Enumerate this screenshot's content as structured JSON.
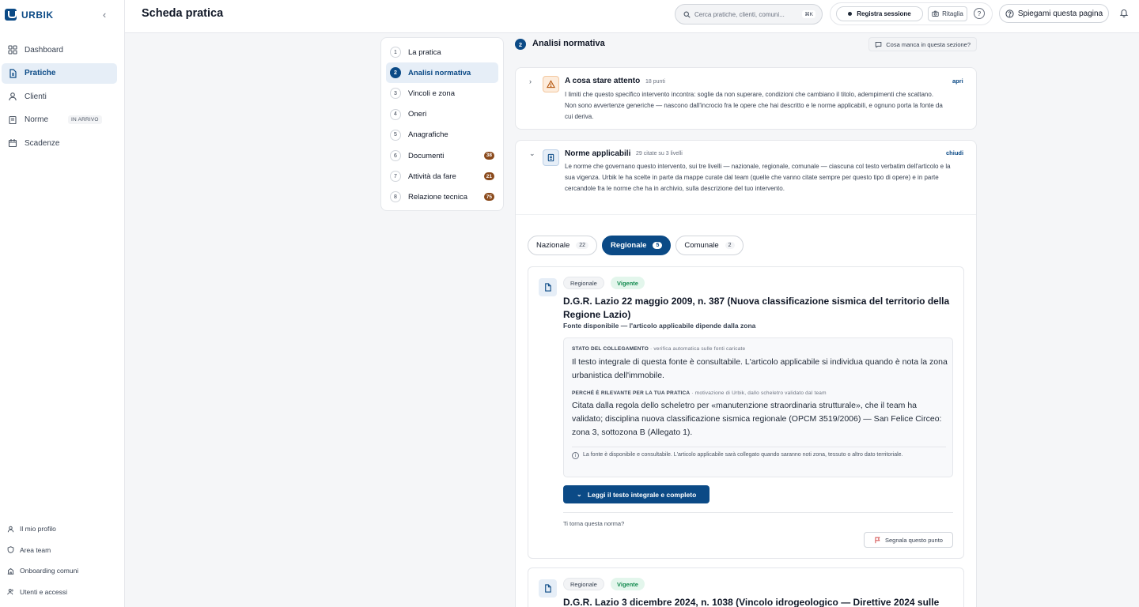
{
  "brand": {
    "name": "URBIK"
  },
  "sidebar": {
    "items": [
      {
        "label": "Dashboard",
        "icon": "grid-icon"
      },
      {
        "label": "Pratiche",
        "icon": "file-icon"
      },
      {
        "label": "Clienti",
        "icon": "user-icon"
      },
      {
        "label": "Norme",
        "icon": "book-icon",
        "badge": "IN ARRIVO"
      },
      {
        "label": "Scadenze",
        "icon": "calendar-icon"
      }
    ],
    "bottom_items": [
      {
        "label": "Il mio profilo",
        "icon": "user-icon"
      },
      {
        "label": "Area team",
        "icon": "shield-icon"
      },
      {
        "label": "Onboarding comuni",
        "icon": "building-icon"
      },
      {
        "label": "Utenti e accessi",
        "icon": "users-icon"
      }
    ]
  },
  "header": {
    "title": "Scheda pratica",
    "search_placeholder": "Cerca pratiche, clienti, comuni...",
    "search_shortcut": "⌘K",
    "record_label": "Registra sessione",
    "crop_label": "Ritaglia",
    "help_symbol": "?",
    "explain_label": "Spiegami questa pagina"
  },
  "stepper": {
    "steps": [
      {
        "num": "1",
        "label": "La pratica"
      },
      {
        "num": "2",
        "label": "Analisi normativa"
      },
      {
        "num": "3",
        "label": "Vincoli e zona"
      },
      {
        "num": "4",
        "label": "Oneri"
      },
      {
        "num": "5",
        "label": "Anagrafiche"
      },
      {
        "num": "6",
        "label": "Documenti",
        "count": "38"
      },
      {
        "num": "7",
        "label": "Attività da fare",
        "count": "21"
      },
      {
        "num": "8",
        "label": "Relazione tecnica",
        "count": "75"
      }
    ]
  },
  "section": {
    "num": "2",
    "title": "Analisi normativa",
    "missing_label": "Cosa manca in questa sezione?"
  },
  "attention_card": {
    "title": "A cosa stare attento",
    "meta": "18 punti",
    "toggle": "apri",
    "description": "I limiti che questo specifico intervento incontra: soglie da non superare, condizioni che cambiano il titolo, adempimenti che scattano. Non sono avvertenze generiche — nascono dall'incrocio fra le opere che hai descritto e le norme applicabili, e ognuno porta la fonte da cui deriva."
  },
  "norms_card": {
    "title": "Norme applicabili",
    "meta": "29 citate su 3 livelli",
    "toggle": "chiudi",
    "description": "Le norme che governano questo intervento, sui tre livelli — nazionale, regionale, comunale — ciascuna col testo verbatim dell'articolo e la sua vigenza. Urbik le ha scelte in parte da mappe curate dal team (quelle che vanno citate sempre per questo tipo di opere) e in parte cercandole fra le norme che ha in archivio, sulla descrizione del tuo intervento.",
    "tabs": [
      {
        "label": "Nazionale",
        "count": "22"
      },
      {
        "label": "Regionale",
        "count": "5"
      },
      {
        "label": "Comunale",
        "count": "2"
      }
    ]
  },
  "norm_items": [
    {
      "level": "Regionale",
      "status": "Vigente",
      "title": "D.G.R. Lazio 22 maggio 2009, n. 387 (Nuova classificazione sismica del territorio della Regione Lazio)",
      "subtitle": "Fonte disponibile — l'articolo applicabile dipende dalla zona",
      "link_state_label": "STATO DEL COLLEGAMENTO",
      "link_state_note": "· verifica automatica sulle fonti caricate",
      "link_state_text": "Il testo integrale di questa fonte è consultabile. L'articolo applicabile si individua quando è nota la zona urbanistica dell'immobile.",
      "relevance_label": "PERCHÉ È RILEVANTE PER LA TUA PRATICA",
      "relevance_note": "· motivazione di Urbik, dallo scheletro validato dal team",
      "relevance_text": "Citata dalla regola dello scheletro per «manutenzione straordinaria strutturale», che il team ha validato; disciplina nuova classificazione sismica regionale (OPCM 3519/2006) — San Felice Circeo: zona 3, sottozona B (Allegato 1).",
      "note": "La fonte è disponibile e consultabile. L'articolo applicabile sarà collegato quando saranno noti zona, tessuto o altro dato territoriale.",
      "read_label": "Leggi il testo integrale e completo",
      "question": "Ti torna questa norma?",
      "flag_label": "Segnala questo punto"
    },
    {
      "level": "Regionale",
      "status": "Vigente",
      "title": "D.G.R. Lazio 3 dicembre 2024, n. 1038 (Vincolo idrogeologico — Direttive 2024 sulle"
    }
  ],
  "colors": {
    "accent": "#0b4a86",
    "count_badge": "#8a4a1c",
    "vigente": "#138a4f",
    "warning": "#b45309"
  }
}
